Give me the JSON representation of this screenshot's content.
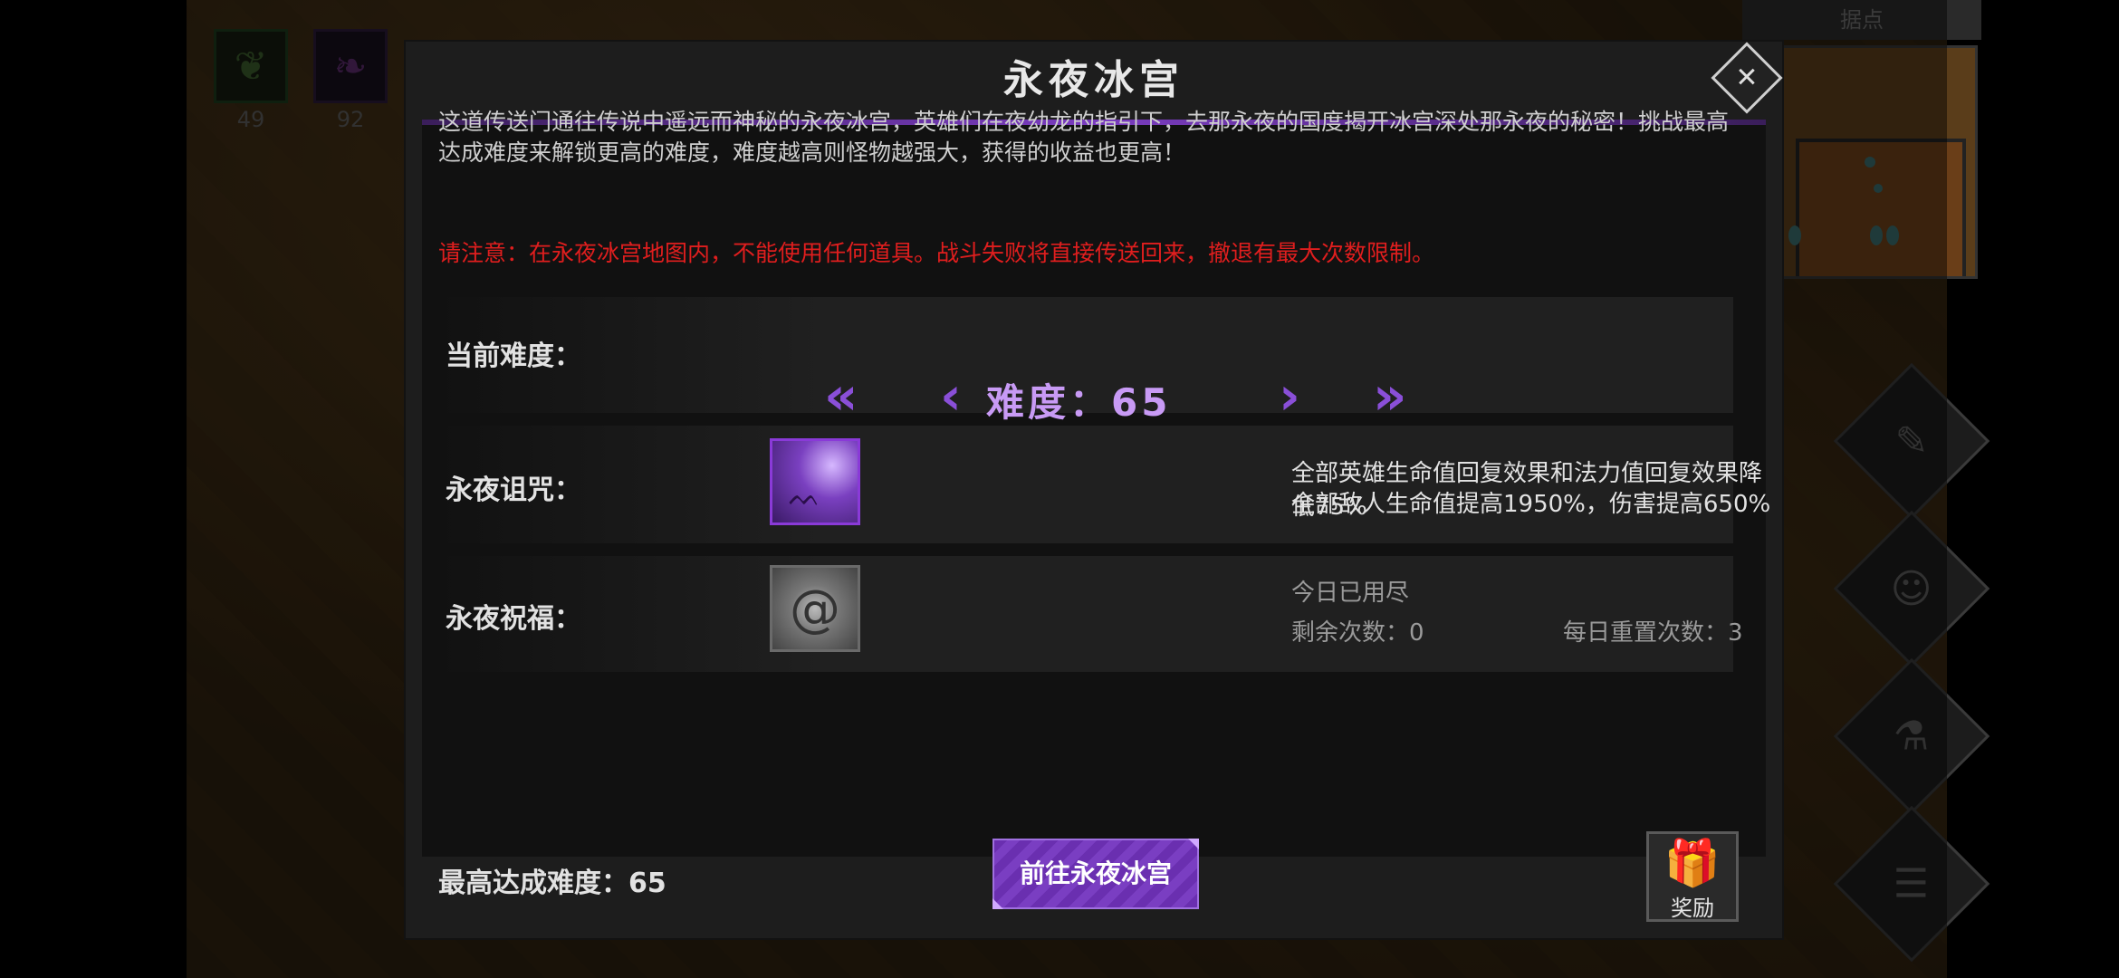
{
  "hud": {
    "items": [
      {
        "icon": "seed-icon",
        "count": "49"
      },
      {
        "icon": "feather-icon",
        "count": "92"
      }
    ],
    "minimap_title": "据点",
    "side_buttons": [
      "scroll-icon",
      "heroes-icon",
      "potion-icon",
      "menu-list-icon"
    ]
  },
  "dialog": {
    "title": "永夜冰宫",
    "description": "这道传送门通往传说中遥远而神秘的永夜冰宫，英雄们在夜幼龙的指引下，去那永夜的国度揭开冰宫深处那永夜的秘密！挑战最高达成难度来解锁更高的难度，难度越高则怪物越强大，获得的收益也更高！",
    "warning": "请注意：在永夜冰宫地图内，不能使用任何道具。战斗失败将直接传送回来，撤退有最大次数限制。",
    "difficulty": {
      "label": "当前难度：",
      "value_text": "难度：65",
      "value": 65
    },
    "curse": {
      "label": "永夜诅咒：",
      "line1": "全部英雄生命值回复效果和法力值回复效果降低75%",
      "line2": "全部敌人生命值提高1950%，伤害提高650%"
    },
    "blessing": {
      "label": "永夜祝福：",
      "status": "今日已用尽",
      "remaining": "剩余次数：0",
      "daily_reset": "每日重置次数：3"
    },
    "max_difficulty": "最高达成难度：65",
    "go_button": "前往永夜冰宫",
    "reward_button": "奖励"
  },
  "colors": {
    "accent": "#7a3cc0",
    "warning": "#e01e1e",
    "difficulty_text": "#c89af5"
  }
}
